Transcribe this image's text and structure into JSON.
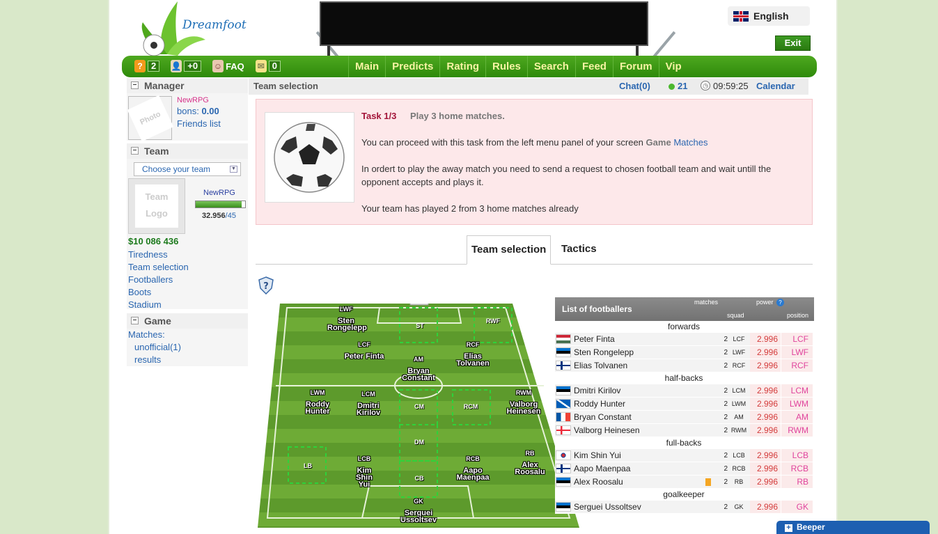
{
  "header": {
    "logo_text": "Dreamfoot",
    "language": "English",
    "exit_label": "Exit"
  },
  "nav_icons": [
    {
      "icon": "question-icon",
      "count": "2"
    },
    {
      "icon": "friends-icon",
      "count": "+0"
    },
    {
      "icon": "faq-icon",
      "count": "FAQ"
    },
    {
      "icon": "mail-icon",
      "count": "0"
    }
  ],
  "menu": [
    "Main",
    "Predicts",
    "Rating",
    "Rules",
    "Search",
    "Feed",
    "Forum",
    "Vip"
  ],
  "sidebar": {
    "manager": {
      "title": "Manager",
      "photo_placeholder": "Photo",
      "username": "NewRPG",
      "bons_label": "bons:",
      "bons_value": "0.00",
      "friends_link": "Friends list"
    },
    "team": {
      "title": "Team",
      "select_value": "Choose your team",
      "logo_placeholder": "Team Logo",
      "team_name": "NewRPG",
      "rating": "32.956",
      "rating_max": "/45",
      "rating_fill": 0.93,
      "money": "$10 086 436",
      "links": [
        "Tiredness",
        "Team selection",
        "Footballers",
        "Boots",
        "Stadium"
      ]
    },
    "game": {
      "title": "Game",
      "matches_label": "Matches:",
      "links": [
        "unofficial(1)",
        "results"
      ]
    }
  },
  "crumb": {
    "title": "Team selection",
    "chat": "Chat(0)",
    "online": "21",
    "clock": "09:59:25",
    "calendar": "Calendar"
  },
  "task": {
    "title": "Task 1/3",
    "subtitle": "Play 3 home matches.",
    "line1": "You can proceed with this task from the left menu panel of your screen",
    "line1_game": "Game",
    "line1_matches": "Matches",
    "line2": "In ordert to play the away match you need to send a request to chosen football team and wait untill the opponent accepts and plays it.",
    "line3": "Your team has played 2 from 3 home matches already"
  },
  "tabs": [
    "Team selection",
    "Tactics"
  ],
  "pitch": {
    "players": [
      {
        "pos": "LWF",
        "name": "Sten Rongelepp"
      },
      {
        "pos": "LCF",
        "name": "Peter Finta"
      },
      {
        "pos": "RCF",
        "name": "Elias Tolvanen"
      },
      {
        "pos": "AM",
        "name": "Bryan Constant"
      },
      {
        "pos": "LWM",
        "name": "Roddy Hunter"
      },
      {
        "pos": "LCM",
        "name": "Dmitri Kirilov"
      },
      {
        "pos": "RWM",
        "name": "Valborg Heinesen"
      },
      {
        "pos": "LCB",
        "name": "Kim Shin Yui"
      },
      {
        "pos": "RCB",
        "name": "Aapo Maenpaa"
      },
      {
        "pos": "RB",
        "name": "Alex Roosalu"
      },
      {
        "pos": "GK",
        "name": "Serguei Ussoltsev"
      }
    ],
    "zones": [
      "ST",
      "RWF",
      "CM",
      "RCM",
      "DM",
      "LB",
      "CB"
    ]
  },
  "list": {
    "title": "List of footballers",
    "col_matches": "matches",
    "col_power": "power",
    "col_squad": "squad",
    "col_position": "position",
    "groups": [
      {
        "name": "forwards",
        "rows": [
          {
            "flag": "hungary",
            "name": "Peter Finta",
            "matches": "2",
            "squad": "LCF",
            "power": "2.996",
            "position": "LCF"
          },
          {
            "flag": "estonia",
            "name": "Sten Rongelepp",
            "matches": "2",
            "squad": "LWF",
            "power": "2.996",
            "position": "LWF"
          },
          {
            "flag": "finland",
            "name": "Elias Tolvanen",
            "matches": "2",
            "squad": "RCF",
            "power": "2.996",
            "position": "RCF"
          }
        ]
      },
      {
        "name": "half-backs",
        "rows": [
          {
            "flag": "estonia",
            "name": "Dmitri Kirilov",
            "matches": "2",
            "squad": "LCM",
            "power": "2.996",
            "position": "LCM"
          },
          {
            "flag": "scotland",
            "name": "Roddy Hunter",
            "matches": "2",
            "squad": "LWM",
            "power": "2.996",
            "position": "LWM"
          },
          {
            "flag": "france",
            "name": "Bryan Constant",
            "matches": "2",
            "squad": "AM",
            "power": "2.996",
            "position": "AM"
          },
          {
            "flag": "faroe",
            "name": "Valborg Heinesen",
            "matches": "2",
            "squad": "RWM",
            "power": "2.996",
            "position": "RWM"
          }
        ]
      },
      {
        "name": "full-backs",
        "rows": [
          {
            "flag": "korea",
            "name": "Kim Shin Yui",
            "matches": "2",
            "squad": "LCB",
            "power": "2.996",
            "position": "LCB"
          },
          {
            "flag": "finland",
            "name": "Aapo Maenpaa",
            "matches": "2",
            "squad": "RCB",
            "power": "2.996",
            "position": "RCB"
          },
          {
            "flag": "estonia",
            "name": "Alex Roosalu",
            "matches": "2",
            "squad": "RB",
            "power": "2.996",
            "position": "RB",
            "card": true
          }
        ]
      },
      {
        "name": "goalkeeper",
        "rows": [
          {
            "flag": "estonia",
            "name": "Serguei Ussoltsev",
            "matches": "2",
            "squad": "GK",
            "power": "2.996",
            "position": "GK"
          }
        ]
      }
    ]
  },
  "beeper": "Beeper",
  "colors": {
    "green": "#2e8a0b",
    "menu_text": "#f7f3a3",
    "link": "#2a66b0",
    "task_bg": "#fde8ea",
    "power": "#d43b3b"
  }
}
